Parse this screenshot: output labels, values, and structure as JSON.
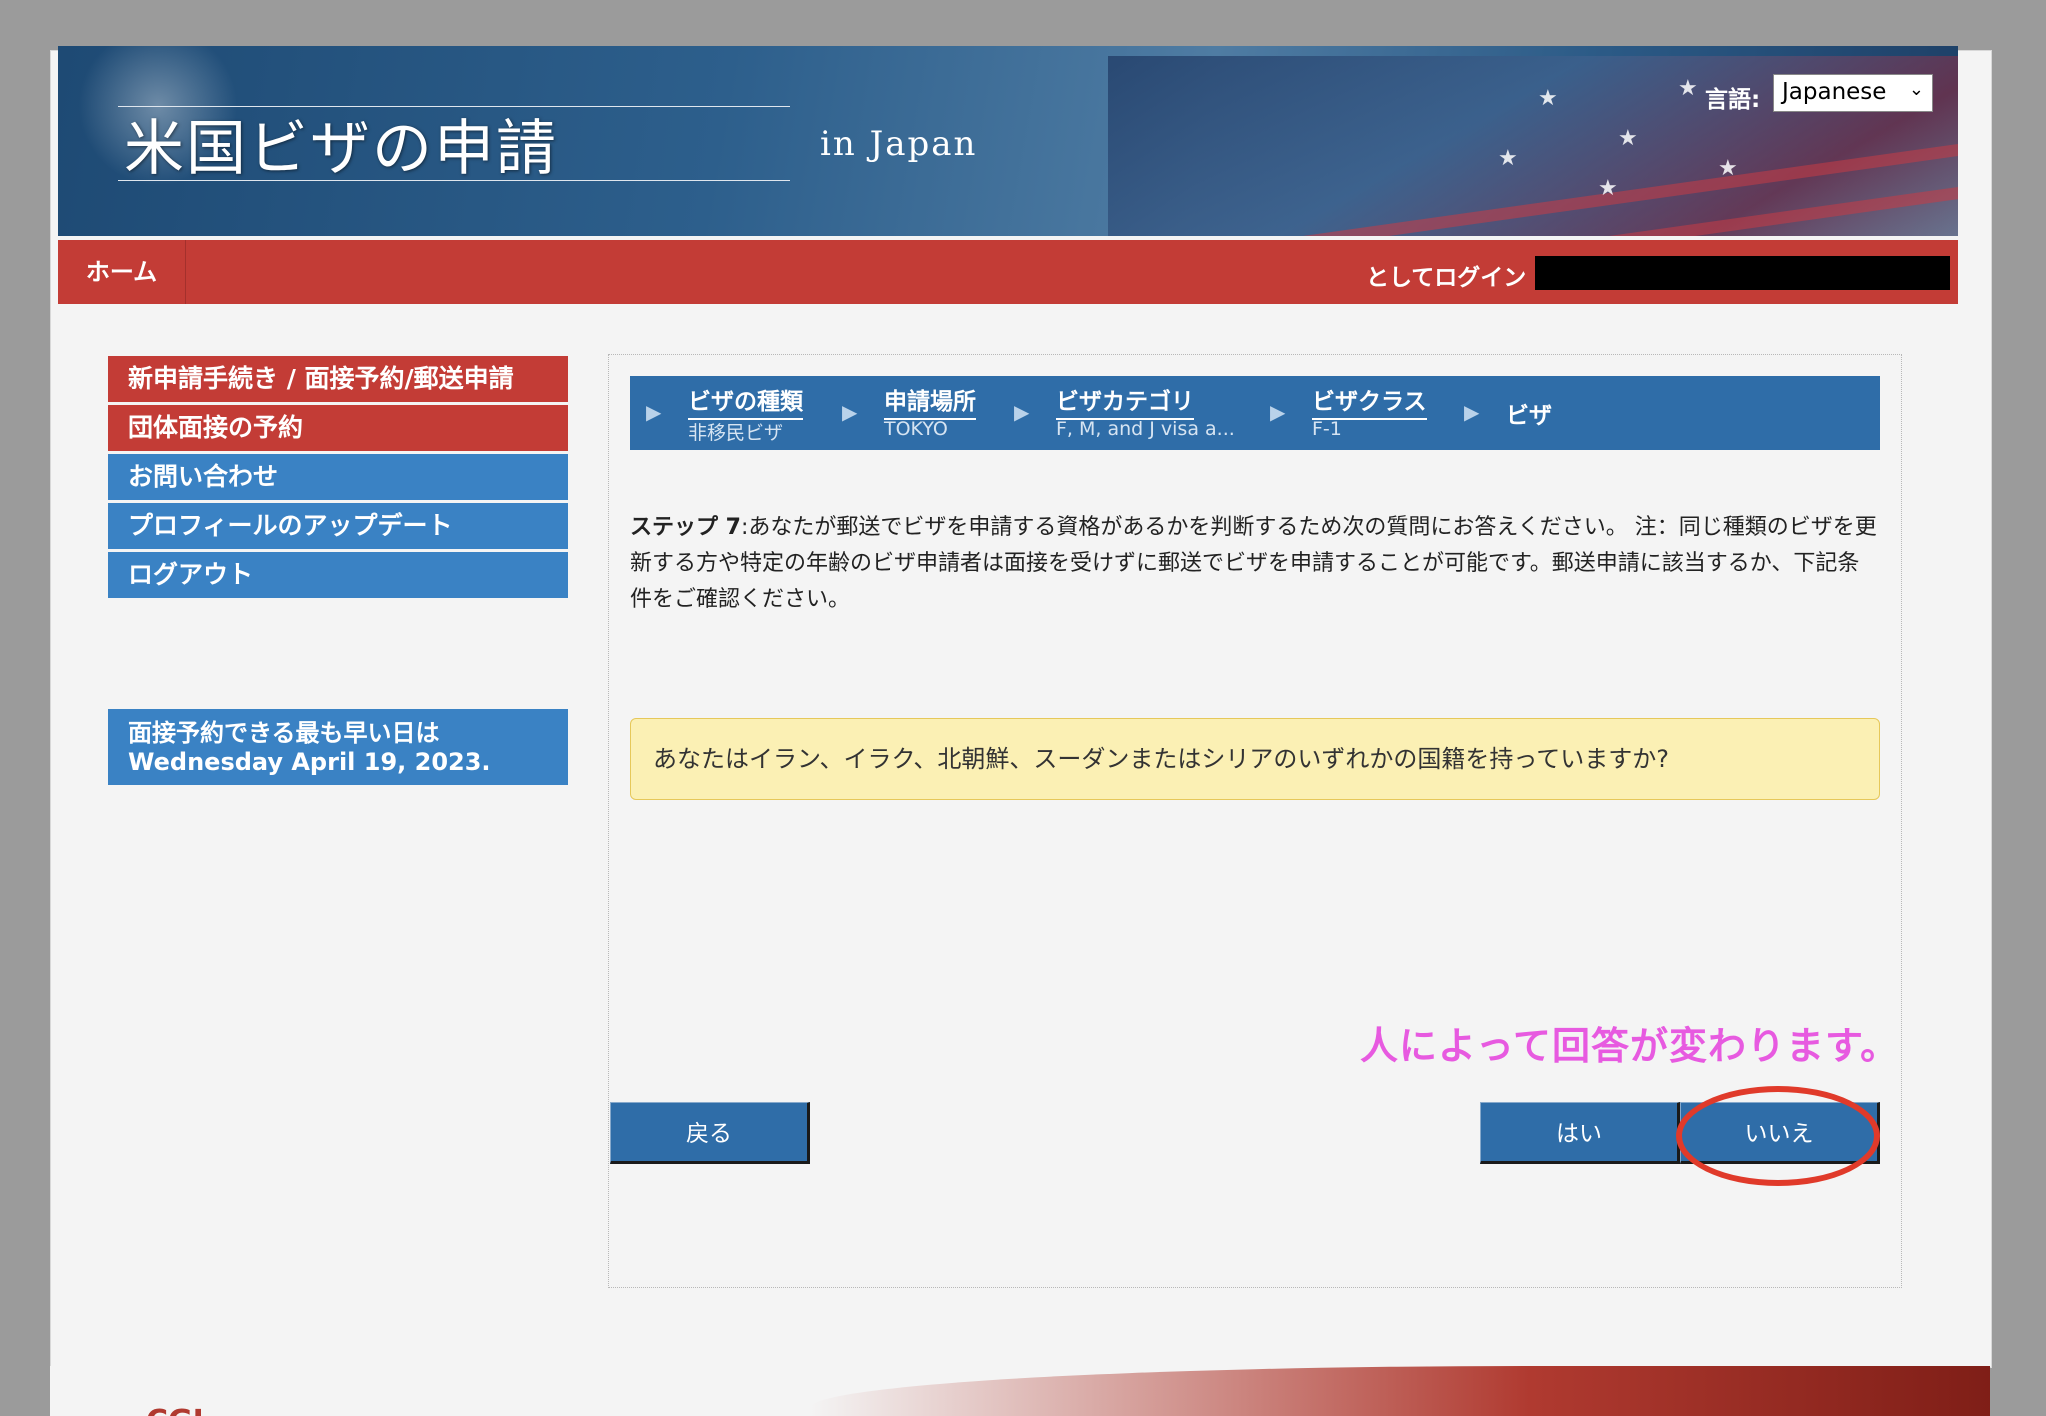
{
  "header": {
    "title": "米国ビザの申請",
    "subtitle": "in  Japan",
    "language_label": "言語:",
    "language_value": "Japanese"
  },
  "nav": {
    "home": "ホーム",
    "logged_in_as": "としてログイン"
  },
  "sidebar": {
    "items": [
      {
        "label": "新申請手続き / 面接予約/郵送申請"
      },
      {
        "label": "団体面接の予約"
      },
      {
        "label": "お問い合わせ"
      },
      {
        "label": "プロフィールのアップデート"
      },
      {
        "label": "ログアウト"
      }
    ],
    "earliest_line1": "面接予約できる最も早い日は",
    "earliest_line2": "Wednesday April 19, 2023."
  },
  "steps": [
    {
      "title": "ビザの種類",
      "sub": "非移民ビザ"
    },
    {
      "title": "申請場所",
      "sub": "TOKYO"
    },
    {
      "title": "ビザカテゴリ",
      "sub": "F, M, and J visa a..."
    },
    {
      "title": "ビザクラス",
      "sub": "F-1"
    },
    {
      "title": "ビザ",
      "sub": ""
    }
  ],
  "main": {
    "step_label": "ステップ 7",
    "instructions": ":あなたが郵送でビザを申請する資格があるかを判断するため次の質問にお答えください。 注：同じ種類のビザを更新する方や特定の年齢のビザ申請者は面接を受けずに郵送でビザを申請することが可能です。郵送申請に該当するか、下記条件をご確認ください。",
    "question": "あなたはイラン、イラク、北朝鮮、スーダンまたはシリアのいずれかの国籍を持っていますか?",
    "annotation": "人によって回答が変わります。",
    "back_button": "戻る",
    "yes_button": "はい",
    "no_button": "いいえ"
  },
  "footer": {
    "logo_text": "CGI"
  },
  "colors": {
    "header_red": "#c33c36",
    "sidebar_blue": "#3a82c4",
    "step_blue": "#2f6da8",
    "question_bg": "#fbf0b4",
    "annotation_pink": "#e75ae0",
    "highlight_red": "#e03a2a"
  }
}
